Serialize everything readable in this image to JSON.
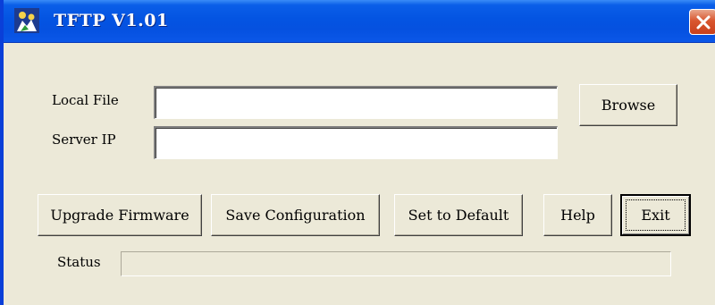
{
  "window": {
    "title": "TFTP V1.01",
    "app_icon": "tftp-app-icon",
    "close_icon": "close-icon"
  },
  "form": {
    "local_file_label": "Local File",
    "local_file_value": "",
    "server_ip_label": "Server IP",
    "server_ip_value": "",
    "browse_label": "Browse"
  },
  "buttons": {
    "upgrade_firmware": "Upgrade Firmware",
    "save_configuration": "Save Configuration",
    "set_to_default": "Set to Default",
    "help": "Help",
    "exit": "Exit"
  },
  "status": {
    "label": "Status",
    "text": ""
  },
  "colors": {
    "titlebar": "#0454e2",
    "face": "#ece9d8",
    "close": "#d9562f"
  }
}
